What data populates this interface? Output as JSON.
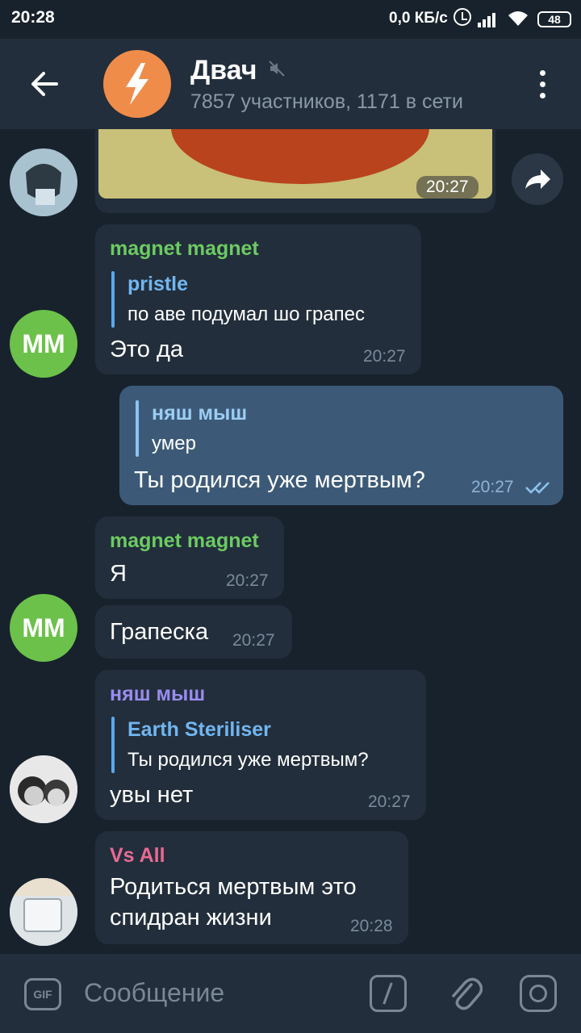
{
  "status_bar": {
    "time": "20:28",
    "network_speed": "0,0 КБ/с",
    "battery": "48"
  },
  "header": {
    "title": "Двач",
    "subtitle": "7857 участников, 1171 в сети",
    "back_icon": "arrow-left-icon",
    "mute_icon": "muted-speaker-icon",
    "menu_icon": "more-vertical-icon"
  },
  "messages": [
    {
      "type": "media",
      "time": "20:27"
    },
    {
      "sender": "magnet magnet",
      "reply_name": "pristle",
      "reply_text": "по аве подумал шо грапес",
      "text": "Это да",
      "time": "20:27"
    },
    {
      "outgoing": true,
      "reply_name": "няш мыш",
      "reply_text": "умер",
      "text": "Ты родился уже мертвым?",
      "time": "20:27"
    },
    {
      "sender": "magnet magnet",
      "text": "Я",
      "time": "20:27"
    },
    {
      "text": "Грапеска",
      "time": "20:27"
    },
    {
      "sender": "няш мыш",
      "reply_name": "Earth Steriliser",
      "reply_text": "Ты родился уже мертвым?",
      "text": "увы нет",
      "time": "20:27"
    },
    {
      "sender": "Vs All",
      "text_line1": "Родиться мертвым это",
      "text_line2": "спидран жизни",
      "time": "20:28"
    }
  ],
  "avatars": {
    "mm_initials": "MM"
  },
  "input": {
    "gif_label": "GIF",
    "placeholder": "Сообщение"
  },
  "colors": {
    "background": "#18222d",
    "header": "#222e3b",
    "incoming_bubble": "#222e3b",
    "outgoing_bubble": "#3c5a78",
    "sender_green": "#6ccb62",
    "sender_purple": "#9a8cf0",
    "sender_pink": "#e86a94",
    "reply_blue": "#71b6f0"
  }
}
